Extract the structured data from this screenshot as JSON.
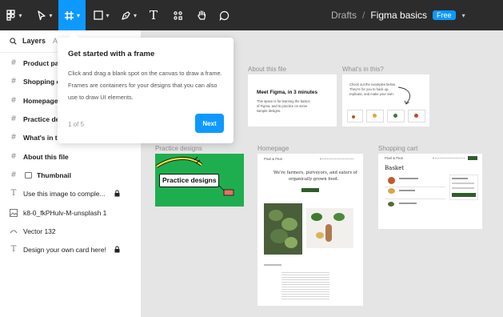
{
  "toolbar": {
    "tools": [
      {
        "name": "main-menu",
        "icon": "figma-menu-icon"
      },
      {
        "name": "move-tool",
        "icon": "cursor-icon"
      },
      {
        "name": "frame-tool",
        "icon": "frame-icon",
        "active": true
      },
      {
        "name": "shape-tool",
        "icon": "rectangle-icon"
      },
      {
        "name": "pen-tool",
        "icon": "pen-icon"
      },
      {
        "name": "text-tool",
        "icon": "text-icon"
      },
      {
        "name": "resources-tool",
        "icon": "components-icon"
      },
      {
        "name": "hand-tool",
        "icon": "hand-icon"
      },
      {
        "name": "comment-tool",
        "icon": "comment-icon"
      }
    ],
    "text_glyph": "T",
    "breadcrumb_folder": "Drafts",
    "breadcrumb_separator": "/",
    "file_name": "Figma basics",
    "plan_badge": "Free"
  },
  "panel": {
    "search_icon": "search-icon",
    "layers_tab": "Layers",
    "assets_tab": "A",
    "items": [
      {
        "label": "Product pa",
        "icon": "frame-icon"
      },
      {
        "label": "Shopping c",
        "icon": "frame-icon"
      },
      {
        "label": "Homepage",
        "icon": "frame-icon"
      },
      {
        "label": "Practice de",
        "icon": "frame-icon"
      },
      {
        "label": "What's in th",
        "icon": "frame-icon"
      },
      {
        "label": "About this file",
        "icon": "frame-icon"
      },
      {
        "label": "Thumbnail",
        "icon": "frame-icon",
        "sub_icon": "component-icon"
      },
      {
        "label": "Use this image to comple...",
        "icon": "text-icon",
        "locked": true
      },
      {
        "label": "k8-0_fkPHulv-M-unsplash 1",
        "icon": "image-icon"
      },
      {
        "label": "Vector 132",
        "icon": "vector-icon"
      },
      {
        "label": "Design your own card here!",
        "icon": "text-icon",
        "locked": true
      }
    ]
  },
  "popover": {
    "title": "Get started with a frame",
    "body": "Click and drag a blank spot on the canvas to draw a frame. Frames are containers for your designs that you can also use to draw UI elements.",
    "step": "1 of 5",
    "next_label": "Next"
  },
  "canvas": {
    "frames": {
      "about": {
        "label": "About this file",
        "heading": "Meet Figma, in 3 minutes",
        "text": [
          "This space is for learning the basics",
          "of Figma, and to practice on some",
          "sample designs."
        ]
      },
      "whats_in": {
        "label": "What's in this?",
        "text": [
          "Check out the examples below.",
          "They're for you to hack up,",
          "replicate, and make your own."
        ]
      },
      "practice": {
        "label": "Practice designs",
        "sticker": "Practice designs"
      },
      "homepage": {
        "label": "Homepage",
        "logo": "Pixel & Pear",
        "headline_1": "We're farmers, purveyors, and eaters of",
        "headline_2": "organically grown food."
      },
      "shopping": {
        "label": "Shopping cart",
        "logo": "Pixel & Pear",
        "heading": "Basket"
      }
    },
    "colors": {
      "canvas_bg": "#e5e5e5",
      "toolbar_bg": "#2c2c2c",
      "accent": "#0d99ff",
      "practice_green": "#1fae4f",
      "brand_green": "#2f5e2b"
    }
  }
}
